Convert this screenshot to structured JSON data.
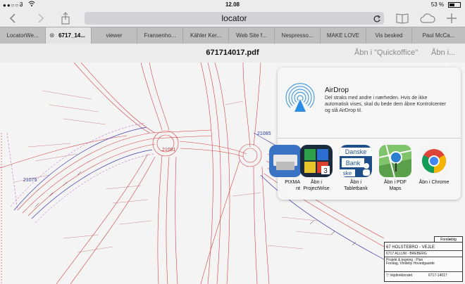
{
  "status_bar": {
    "signal": "●●○○○",
    "carrier": "3",
    "time": "12.08",
    "battery_percent": "53 %",
    "battery_level": 0.53
  },
  "browser": {
    "url": "locator",
    "icons": [
      "back-icon",
      "forward-icon",
      "share-icon",
      "reload-icon",
      "reading-list-icon",
      "icloud-tabs-icon",
      "new-tab-icon"
    ],
    "tabs": [
      {
        "label": "LocatorWe...",
        "active": false
      },
      {
        "label": "6717_14...",
        "active": true
      },
      {
        "label": "viewer",
        "active": false
      },
      {
        "label": "Fransenho...",
        "active": false
      },
      {
        "label": "Kähler Ker...",
        "active": false
      },
      {
        "label": "Web Site f...",
        "active": false
      },
      {
        "label": "Nespresso...",
        "active": false
      },
      {
        "label": "MAKE LOVE",
        "active": false
      },
      {
        "label": "Vis besked",
        "active": false
      },
      {
        "label": "Paul McCa...",
        "active": false
      }
    ]
  },
  "pdf": {
    "title": "671714017.pdf",
    "open_in_quickoffice": "Åbn i \"Quickoffice\"",
    "open_in_more": "Åbn i..."
  },
  "drawing": {
    "labels": [
      "21075",
      "21085",
      "21081"
    ],
    "title_block": {
      "status": "Forelæbig",
      "project": "67 HOLSTEBRO - VEJLE",
      "section": "6717 ALLUM - BREBERG",
      "line3": "Projekt & tegning : Plan",
      "line4": "Forslag, Vindeby Hovedgaarde",
      "authority": "Vejdirektoratet",
      "drawing_no": "6717-14017"
    }
  },
  "share_sheet": {
    "airdrop_title": "AirDrop",
    "airdrop_desc": "Del straks med andre i nærheden. Hvis de ikke automatisk vises, skal du bede dem åbne Kontrolcenter og slå AirDrop til.",
    "apps": [
      {
        "name": "PIXMA\nnt",
        "icon": "pixma-icon"
      },
      {
        "name": "Åbn i\nProjectWise",
        "icon": "projectwise-icon"
      },
      {
        "name": "Åbn i\nTabletbank",
        "icon": "danske-bank-icon"
      },
      {
        "name": "Åbn i PDF\nMaps",
        "icon": "pdf-maps-icon"
      },
      {
        "name": "Åbn i Chrome",
        "icon": "chrome-icon"
      }
    ],
    "danske_bank_tile_text": [
      "Danske",
      "Bank",
      "ske"
    ]
  },
  "colors": {
    "airdrop_blue": "#2a8ee6",
    "road_red": "#d94040",
    "label_blue": "#2a3aa8"
  }
}
